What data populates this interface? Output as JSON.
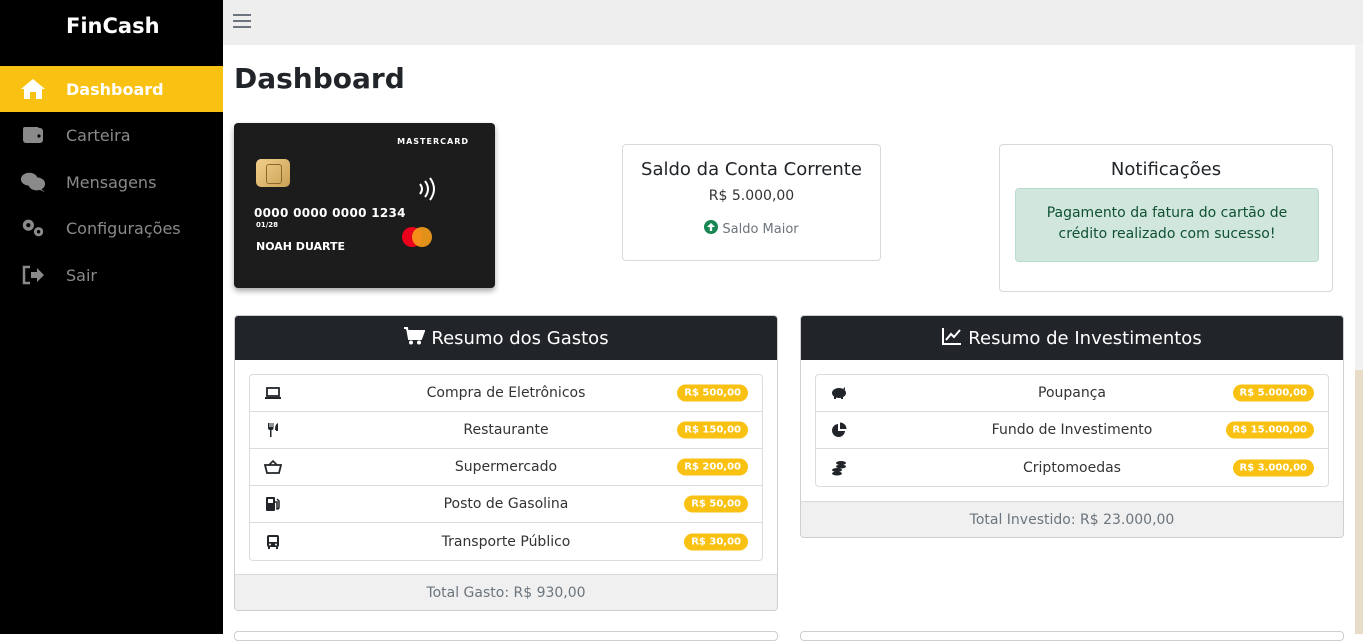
{
  "app": {
    "brand": "FinCash"
  },
  "sidebar": {
    "items": [
      {
        "label": "Dashboard",
        "icon": "home-icon",
        "active": true
      },
      {
        "label": "Carteira",
        "icon": "wallet-icon"
      },
      {
        "label": "Mensagens",
        "icon": "comments-icon"
      },
      {
        "label": "Configurações",
        "icon": "cogs-icon"
      },
      {
        "label": "Sair",
        "icon": "sign-out-icon"
      }
    ]
  },
  "page": {
    "title": "Dashboard"
  },
  "card": {
    "brand": "MASTERCARD",
    "number": "0000 0000 0000 1234",
    "expiry": "01/28",
    "holder": "NOAH DUARTE"
  },
  "saldo": {
    "title": "Saldo da Conta Corrente",
    "value": "R$ 5.000,00",
    "trend": "Saldo Maior",
    "trend_color": "#198754"
  },
  "notificacoes": {
    "title": "Notificações",
    "message": "Pagamento da fatura do cartão de crédito realizado com sucesso!"
  },
  "gastos": {
    "title": "Resumo dos Gastos",
    "items": [
      {
        "label": "Compra de Eletrônicos",
        "value": "R$ 500,00",
        "icon": "laptop-icon"
      },
      {
        "label": "Restaurante",
        "value": "R$ 150,00",
        "icon": "utensils-icon"
      },
      {
        "label": "Supermercado",
        "value": "R$ 200,00",
        "icon": "basket-icon"
      },
      {
        "label": "Posto de Gasolina",
        "value": "R$ 50,00",
        "icon": "gas-pump-icon"
      },
      {
        "label": "Transporte Público",
        "value": "R$ 30,00",
        "icon": "bus-icon"
      }
    ],
    "total": "Total Gasto: R$ 930,00"
  },
  "investimentos": {
    "title": "Resumo de Investimentos",
    "items": [
      {
        "label": "Poupança",
        "value": "R$ 5.000,00",
        "icon": "piggy-bank-icon"
      },
      {
        "label": "Fundo de Investimento",
        "value": "R$ 15.000,00",
        "icon": "pie-chart-icon"
      },
      {
        "label": "Criptomoedas",
        "value": "R$ 3.000,00",
        "icon": "coins-icon"
      }
    ],
    "total": "Total Investido: R$ 23.000,00"
  },
  "colors": {
    "accent": "#f9c213",
    "sidebar_bg": "#000000",
    "panel_head": "#212529"
  }
}
